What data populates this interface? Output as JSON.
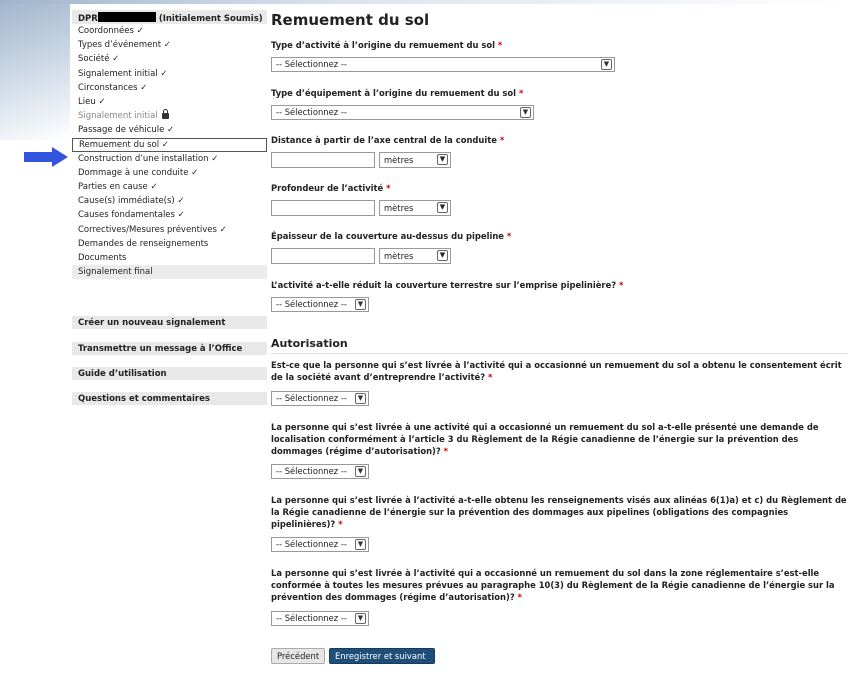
{
  "sidebar": {
    "header_prefix": "DPR",
    "header_suffix": "(Initialement Soumis)",
    "items": [
      {
        "label": "Coordonnées ✓"
      },
      {
        "label": "Types d’événement ✓"
      },
      {
        "label": "Société ✓"
      },
      {
        "label": "Signalement initial ✓"
      },
      {
        "label": "Circonstances ✓"
      },
      {
        "label": "Lieu ✓"
      },
      {
        "label": "Signalement initial"
      },
      {
        "label": "Passage de véhicule ✓"
      },
      {
        "label": "Remuement du sol ✓"
      },
      {
        "label": "Construction d’une installation ✓"
      },
      {
        "label": "Dommage à une conduite ✓"
      },
      {
        "label": "Parties en cause ✓"
      },
      {
        "label": "Cause(s) immédiate(s) ✓"
      },
      {
        "label": "Causes fondamentales ✓"
      },
      {
        "label": "Correctives/Mesures préventives ✓"
      },
      {
        "label": "Demandes de renseignements"
      },
      {
        "label": "Documents"
      },
      {
        "label": "Signalement final"
      }
    ],
    "links": [
      {
        "label": "Créer un nouveau signalement"
      },
      {
        "label": "Transmettre un message à l’Office"
      },
      {
        "label": "Guide d’utilisation"
      },
      {
        "label": "Questions et commentaires"
      }
    ]
  },
  "main": {
    "title": "Remuement du sol",
    "select_placeholder": "-- Sélectionnez --",
    "unit_value": "mètres",
    "required_mark": "*",
    "fields": {
      "activity_type": "Type d’activité à l’origine du remuement du sol",
      "equipment_type": "Type d’équipement à l’origine du remuement du sol",
      "distance": "Distance à partir de l’axe central de la conduite",
      "depth": "Profondeur de l’activité",
      "cover_thickness": "Épaisseur de la couverture au-dessus du pipeline",
      "cover_reduced": "L’activité a-t-elle réduit la couverture terrestre sur l’emprise pipelinière?"
    },
    "authorization": {
      "title": "Autorisation",
      "q1": "Est-ce que la personne qui s’est livrée à l’activité qui a occasionné un remuement du sol a obtenu le consentement écrit de la société avant d’entreprendre l’activité?",
      "q2": "La personne qui s’est livrée à une activité qui a occasionné un remuement du sol a-t-elle présenté une demande de localisation conformément à l’article 3 du Règlement de la Régie canadienne de l’énergie sur la prévention des dommages (régime d’autorisation)?",
      "q3": "La personne qui s’est livrée à l’activité a-t-elle obtenu les renseignements visés aux alinéas 6(1)a) et c) du Règlement de la Régie canadienne de l’énergie sur la prévention des dommages aux pipelines (obligations des compagnies pipelinières)?",
      "q4": "La personne qui s’est livrée à l’activité qui a occasionné un remuement du sol dans la zone réglementaire s’est-elle conformée à toutes les mesures prévues au paragraphe 10(3) du Règlement de la Régie canadienne de l’énergie sur la prévention des dommages (régime d’autorisation)?"
    },
    "buttons": {
      "previous": "Précédent",
      "save_next": "Enregistrer et suivant"
    }
  },
  "colors": {
    "primary_button": "#1f4e79",
    "required": "#d00000",
    "arrow": "#3355dd"
  }
}
